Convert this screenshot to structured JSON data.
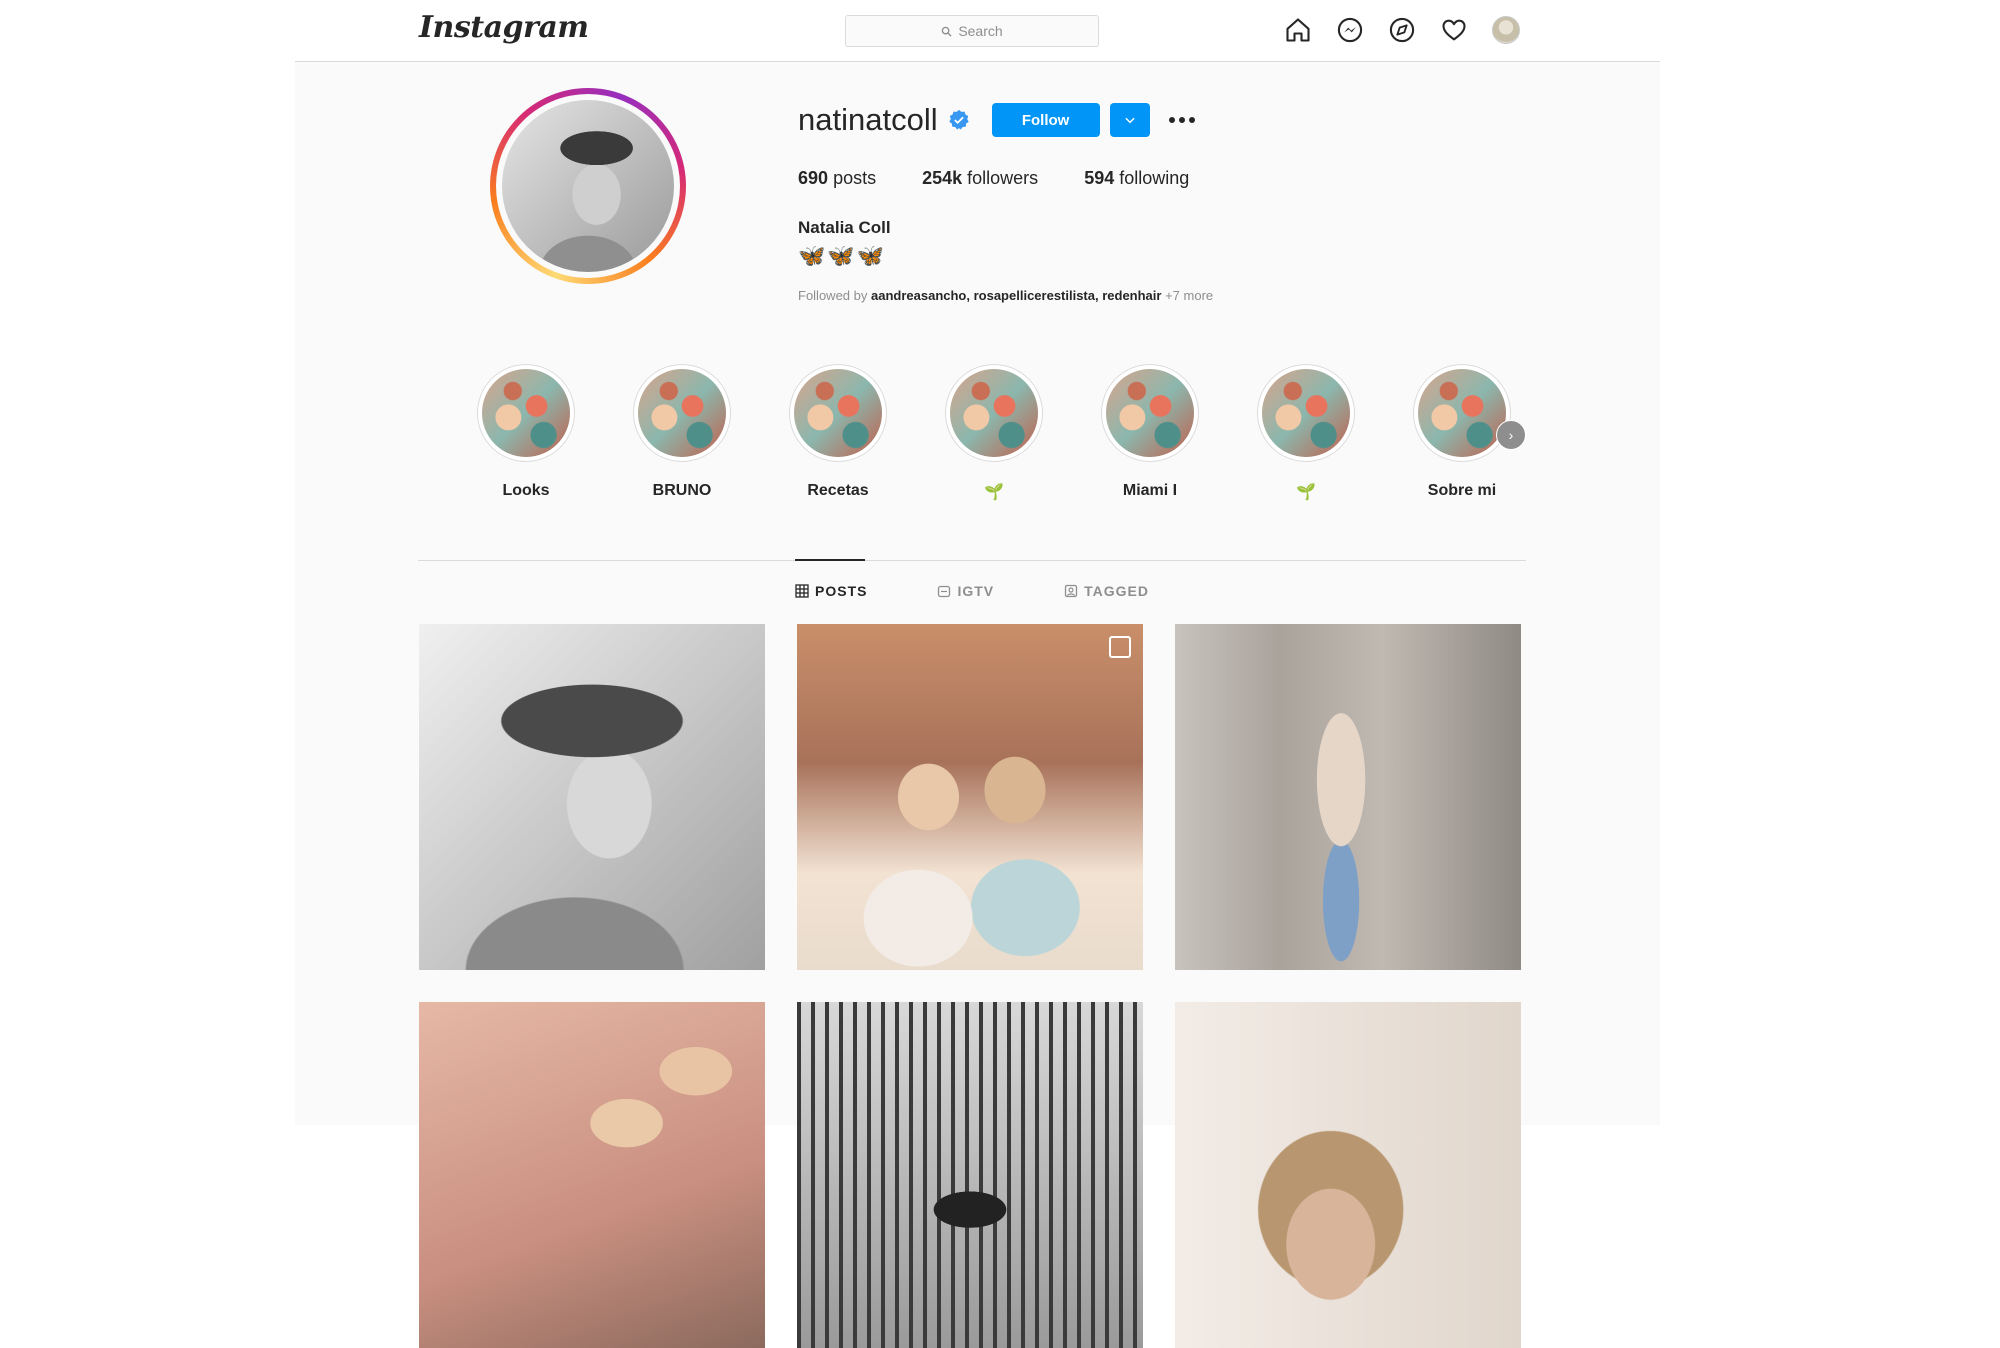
{
  "header": {
    "logo": "Instagram",
    "search_placeholder": "Search",
    "nav_icons": [
      "home-icon",
      "messenger-icon",
      "explore-icon",
      "heart-icon",
      "profile-avatar"
    ]
  },
  "profile": {
    "username": "natinatcoll",
    "verified": true,
    "follow_label": "Follow",
    "stats": {
      "posts_count": "690",
      "posts_label": "posts",
      "followers_count": "254k",
      "followers_label": "followers",
      "following_count": "594",
      "following_label": "following"
    },
    "full_name": "Natalia Coll",
    "bio": "🦋🦋🦋",
    "followed_by": {
      "prefix": "Followed by",
      "names": "aandreasancho, rosapellicerestilista, redenhair",
      "more": "+7 more"
    }
  },
  "highlights": [
    {
      "label": "Looks"
    },
    {
      "label": "BRUNO"
    },
    {
      "label": "Recetas"
    },
    {
      "label": "🌱"
    },
    {
      "label": "Miami I"
    },
    {
      "label": "🌱"
    },
    {
      "label": "Sobre mi"
    }
  ],
  "tabs": [
    {
      "label": "POSTS",
      "active": true
    },
    {
      "label": "IGTV",
      "active": false
    },
    {
      "label": "TAGGED",
      "active": false
    }
  ],
  "colors": {
    "accent": "#0095f6",
    "text": "#262626",
    "muted": "#8e8e8e",
    "border": "#dbdbdb"
  }
}
